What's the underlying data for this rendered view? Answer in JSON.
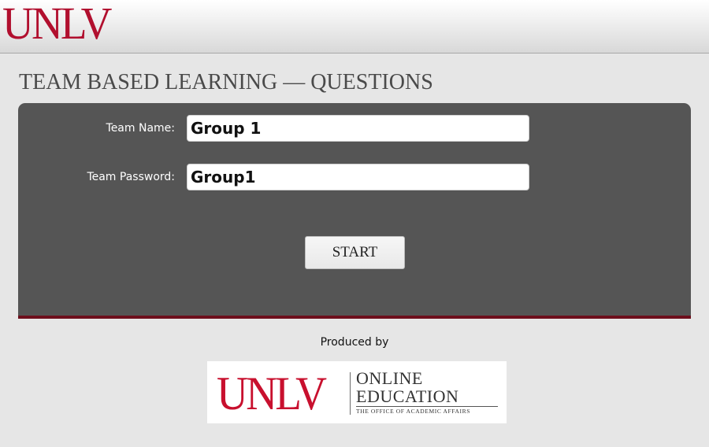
{
  "header": {
    "logo_text": "UNLV",
    "logo_color": "#b10f2e"
  },
  "page": {
    "title": "TEAM BASED LEARNING — QUESTIONS"
  },
  "form": {
    "team_name_label": "Team Name:",
    "team_name_value": "Group 1",
    "team_password_label": "Team Password:",
    "team_password_value": "Group1",
    "start_label": "START",
    "panel_color": "#555555",
    "accent_border_color": "#6d0f1c"
  },
  "footer": {
    "produced_by": "Produced by",
    "logo": {
      "mark": "UNLV",
      "line1": "ONLINE",
      "line2": "EDUCATION",
      "line3": "THE OFFICE OF ACADEMIC AFFAIRS",
      "mark_color": "#c8102e"
    }
  }
}
